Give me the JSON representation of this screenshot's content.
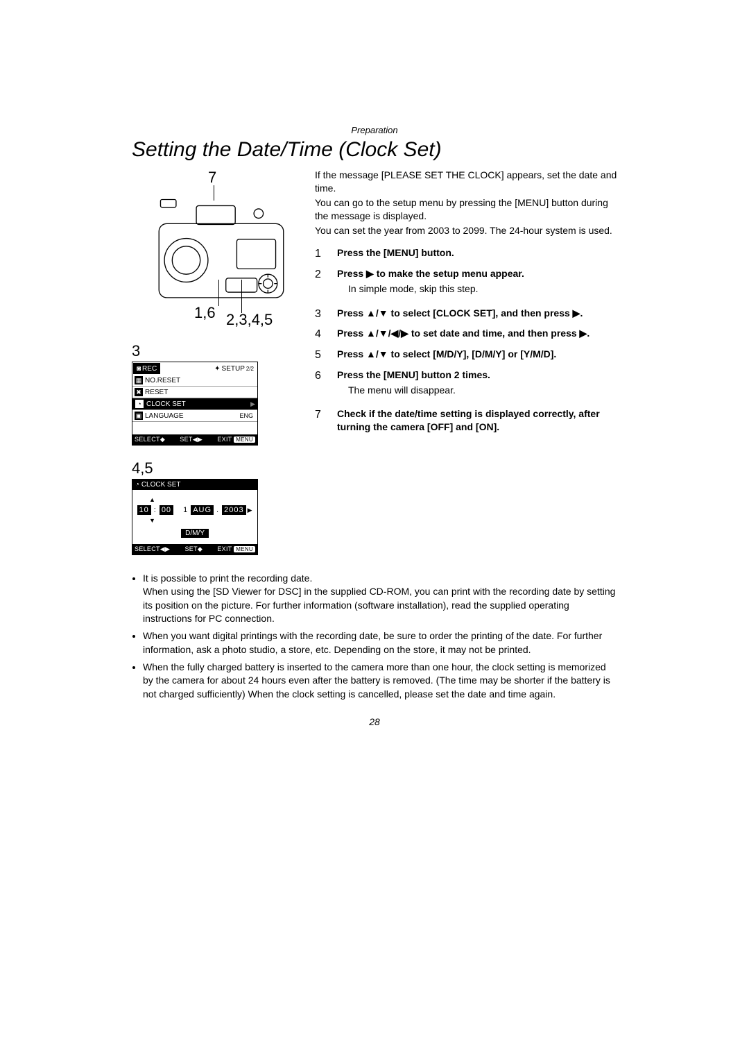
{
  "section": "Preparation",
  "title": "Setting the Date/Time (Clock Set)",
  "intro": {
    "p1": "If the message [PLEASE SET THE CLOCK] appears, set the date and time.",
    "p2": "You can go to the setup menu by pressing the [MENU] button during the message is displayed.",
    "p3": "You can set the year from 2003 to 2099. The 24-hour system is used."
  },
  "callouts": {
    "top": "7",
    "bottom_left": "1,6",
    "bottom_right": "2,3,4,5"
  },
  "diagram_label_3": "3",
  "menu_screen": {
    "tab_rec": "REC",
    "tab_setup": "SETUP",
    "tab_setup_page": "2/2",
    "rows": {
      "no_reset": "NO.RESET",
      "reset": "RESET",
      "clock_set": "CLOCK SET",
      "language": "LANGUAGE",
      "language_val": "ENG"
    },
    "footer_select": "SELECT",
    "footer_set": "SET",
    "footer_exit": "EXIT",
    "footer_exit_tag": "MENU"
  },
  "diagram_label_45": "4,5",
  "clock_screen": {
    "header": "CLOCK SET",
    "hour": "10",
    "minute": "00",
    "day": "1",
    "month": "AUG",
    "year": "2003",
    "format": "D/M/Y",
    "footer_select": "SELECT",
    "footer_set": "SET",
    "footer_exit": "EXIT",
    "footer_exit_tag": "MENU"
  },
  "steps": [
    {
      "num": "1",
      "head": "Press the [MENU] button."
    },
    {
      "num": "2",
      "head": "Press ▶ to make the setup menu appear.",
      "sub": "In simple mode, skip this step."
    },
    {
      "num": "3",
      "head": "Press ▲/▼ to select [CLOCK SET], and then press ▶."
    },
    {
      "num": "4",
      "head": "Press ▲/▼/◀/▶ to set date and time, and then press ▶."
    },
    {
      "num": "5",
      "head": "Press ▲/▼ to select [M/D/Y], [D/M/Y] or [Y/M/D]."
    },
    {
      "num": "6",
      "head": "Press the [MENU] button 2 times.",
      "sub": "The menu will disappear."
    },
    {
      "num": "7",
      "head": "Check if the date/time setting is displayed correctly, after turning the camera [OFF] and [ON]."
    }
  ],
  "bottom_notes": [
    "It is possible to print the recording date.\nWhen using the [SD Viewer for DSC] in the supplied CD-ROM, you can print with the recording date by setting its position on the picture. For further information (software installation), read the supplied operating instructions for PC connection.",
    "When you want digital printings with the recording date, be sure to order the printing of the date. For further information, ask a photo studio, a store, etc. Depending on the store, it may not be printed.",
    "When the fully charged battery is inserted to the camera more than one hour, the clock setting is memorized by the camera for about 24 hours even after the battery is removed. (The time may be shorter if the battery is not charged sufficiently) When the clock setting is cancelled, please set the date and time again."
  ],
  "page_number": "28"
}
